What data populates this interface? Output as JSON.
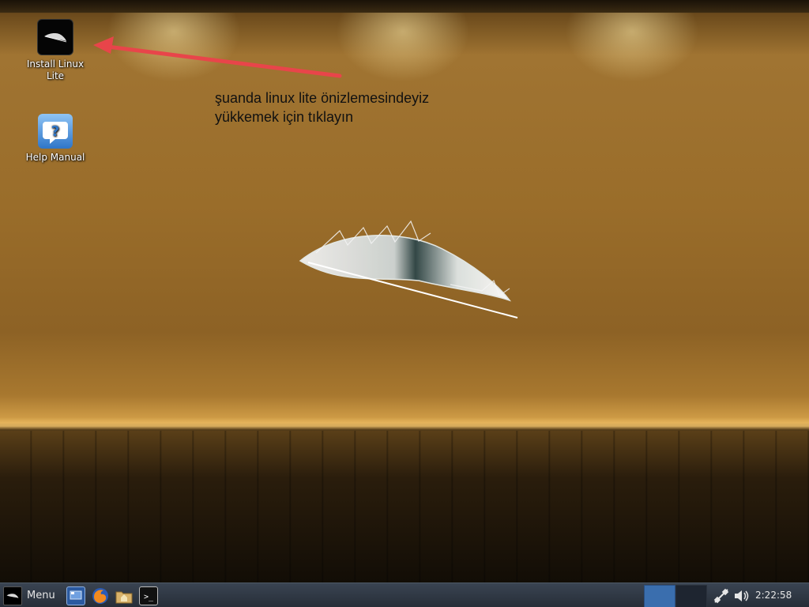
{
  "desktop": {
    "icons": [
      {
        "label": "Install Linux Lite",
        "icon": "linux-lite-feather-icon"
      },
      {
        "label": "Help Manual",
        "icon": "help-question-icon"
      }
    ],
    "annotation": {
      "line1": "şuanda linux lite önizlemesindeyiz",
      "line2": "yükkemek için tıklayın",
      "arrow_color": "#e8454a"
    }
  },
  "taskbar": {
    "menu_label": "Menu",
    "launchers": [
      "desktop-show-icon",
      "firefox-icon",
      "file-manager-icon",
      "terminal-icon"
    ],
    "workspace_active_color": "#3a6eae",
    "clock": "2:22:58 pm"
  }
}
